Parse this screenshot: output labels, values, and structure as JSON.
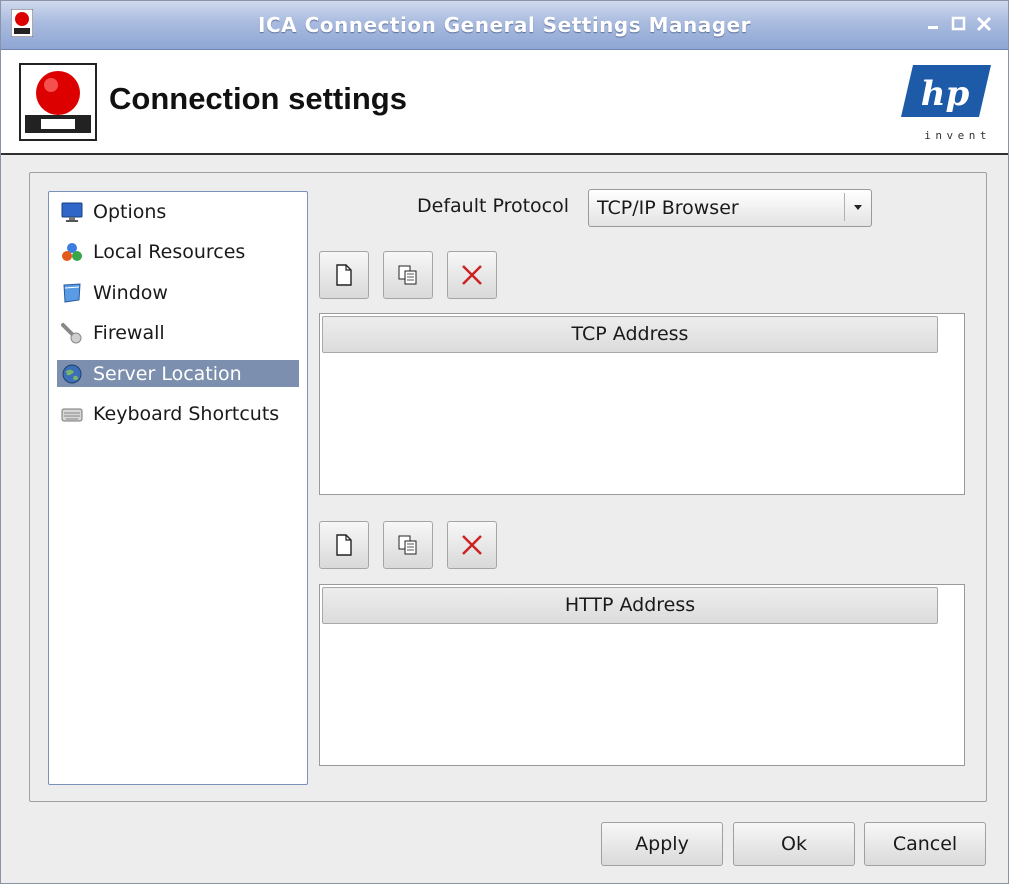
{
  "window": {
    "title": "ICA Connection General Settings Manager"
  },
  "header": {
    "heading": "Connection settings",
    "logo_tagline": "invent"
  },
  "sidebar": {
    "items": [
      {
        "label": "Options",
        "icon": "monitor-icon"
      },
      {
        "label": "Local Resources",
        "icon": "resources-icon"
      },
      {
        "label": "Window",
        "icon": "window-icon"
      },
      {
        "label": "Firewall",
        "icon": "firewall-icon"
      },
      {
        "label": "Server Location",
        "icon": "globe-icon",
        "selected": true
      },
      {
        "label": "Keyboard Shortcuts",
        "icon": "keyboard-icon"
      }
    ]
  },
  "protocol": {
    "label": "Default Protocol",
    "value": "TCP/IP Browser"
  },
  "tcp_table": {
    "column": "TCP Address",
    "rows": []
  },
  "http_table": {
    "column": "HTTP Address",
    "rows": []
  },
  "buttons": {
    "apply": "Apply",
    "ok": "Ok",
    "cancel": "Cancel"
  },
  "colors": {
    "title_bar": "#a9bbdf",
    "selection": "#7c8fae",
    "delete_x": "#cc2222"
  }
}
